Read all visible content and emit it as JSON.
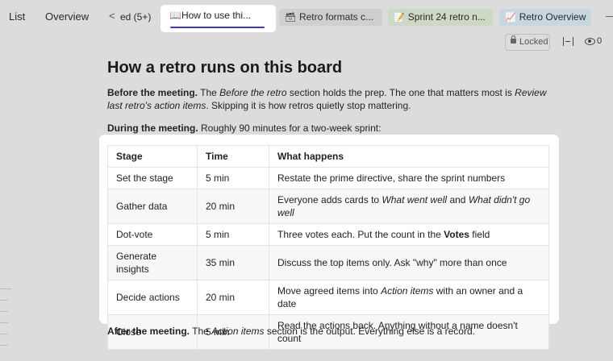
{
  "topbar": {
    "nav_list": "List",
    "nav_overview": "Overview",
    "prev_chevron": "<",
    "tabs": [
      {
        "label": "ed (5+)",
        "icon": "",
        "color": "#dcdcdc"
      },
      {
        "label": "How to use thi...",
        "icon": "book-icon",
        "glyph": "📖",
        "color": "#ffffff"
      },
      {
        "label": "Retro formats c...",
        "icon": "box-icon",
        "glyph": "🗃",
        "color": "#cfcfcf"
      },
      {
        "label": "Sprint 24 retro n...",
        "icon": "note-icon",
        "glyph": "📝",
        "color": "#cdd9c4"
      },
      {
        "label": "Retro Overview",
        "icon": "chart-icon",
        "glyph": "📈",
        "color": "#c8d6e0"
      }
    ]
  },
  "actions": {
    "locked_label": "Locked",
    "views_count": "0"
  },
  "doc": {
    "title": "How a retro runs on this board",
    "before_bold": "Before the meeting.",
    "before_t1": " The ",
    "before_i1": "Before the retro",
    "before_t2": " section holds the prep. The one that matters most is ",
    "before_i2": "Review last retro's action items",
    "before_t3": ". Skipping it is how retros quietly stop mattering.",
    "during_bold": "During the meeting.",
    "during_text": " Roughly 90 minutes for a two-week sprint:",
    "after_bold": "After the meeting.",
    "after_t1": " The ",
    "after_i1": "Action items",
    "after_t2": " section is the output. Everything else is a record."
  },
  "table": {
    "headers": [
      "Stage",
      "Time",
      "What happens"
    ],
    "rows": [
      {
        "stage": "Set the stage",
        "time": "5 min",
        "what": "Restate the prime directive, share the sprint numbers"
      },
      {
        "stage": "Gather data",
        "time": "20 min",
        "what_t1": "Everyone adds cards to ",
        "what_i1": "What went well",
        "what_t2": " and ",
        "what_i2": "What didn't go well"
      },
      {
        "stage": "Dot-vote",
        "time": "5 min",
        "what_t1": "Three votes each. Put the count in the ",
        "what_b1": "Votes",
        "what_t2": " field"
      },
      {
        "stage": "Generate insights",
        "time": "35 min",
        "what": "Discuss the top items only. Ask \"why\" more than once"
      },
      {
        "stage": "Decide actions",
        "time": "20 min",
        "what_t1": "Move agreed items into ",
        "what_i1": "Action items",
        "what_t2": " with an owner and a date"
      },
      {
        "stage": "Close",
        "time": "5 min",
        "what": "Read the actions back. Anything without a name doesn't count"
      }
    ]
  }
}
